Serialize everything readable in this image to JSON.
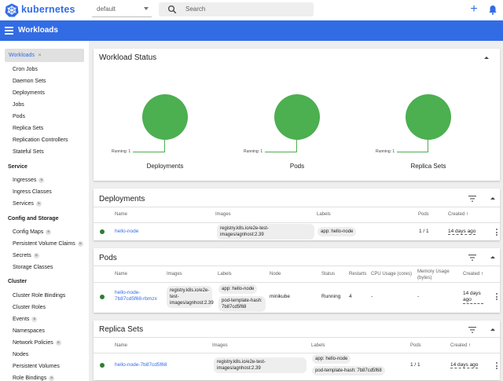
{
  "topbar": {
    "brand": "kubernetes",
    "namespace": "default",
    "search_placeholder": "Search",
    "create_glyph": "+",
    "icons": [
      "kubernetes-logo-icon",
      "chevron-down-icon",
      "search-icon",
      "plus-icon",
      "bell-icon"
    ]
  },
  "header": {
    "title": "Workloads",
    "menu_icon": "menu-icon"
  },
  "colors": {
    "primary": "#326ce5",
    "running": "#4caf50",
    "status_ok": "#2e7d32"
  },
  "sidebar": {
    "workloads": {
      "label": "Workloads",
      "badge": "N"
    },
    "workload_items": [
      "Cron Jobs",
      "Daemon Sets",
      "Deployments",
      "Jobs",
      "Pods",
      "Replica Sets",
      "Replication Controllers",
      "Stateful Sets"
    ],
    "service_heading": "Service",
    "service_items": [
      {
        "label": "Ingresses",
        "badge": "N"
      },
      {
        "label": "Ingress Classes",
        "badge": ""
      },
      {
        "label": "Services",
        "badge": "N"
      }
    ],
    "config_heading": "Config and Storage",
    "config_items": [
      {
        "label": "Config Maps",
        "badge": "N"
      },
      {
        "label": "Persistent Volume Claims",
        "badge": "N"
      },
      {
        "label": "Secrets",
        "badge": "N"
      },
      {
        "label": "Storage Classes",
        "badge": ""
      }
    ],
    "cluster_heading": "Cluster",
    "cluster_items": [
      {
        "label": "Cluster Role Bindings",
        "badge": ""
      },
      {
        "label": "Cluster Roles",
        "badge": ""
      },
      {
        "label": "Events",
        "badge": "N"
      },
      {
        "label": "Namespaces",
        "badge": ""
      },
      {
        "label": "Network Policies",
        "badge": "N"
      },
      {
        "label": "Nodes",
        "badge": ""
      },
      {
        "label": "Persistent Volumes",
        "badge": ""
      },
      {
        "label": "Role Bindings",
        "badge": "N"
      }
    ]
  },
  "workload_status": {
    "title": "Workload Status",
    "charts": [
      {
        "label": "Deployments",
        "running_label": "Running: 1",
        "running": 1
      },
      {
        "label": "Pods",
        "running_label": "Running: 1",
        "running": 1
      },
      {
        "label": "Replica Sets",
        "running_label": "Running: 1",
        "running": 1
      }
    ]
  },
  "deployments": {
    "title": "Deployments",
    "columns": {
      "name": "Name",
      "images": "Images",
      "labels": "Labels",
      "pods": "Pods",
      "created": "Created"
    },
    "rows": [
      {
        "name": "hello-node",
        "image": "registry.k8s.io/e2e-test-images/agnhost:2.39",
        "labels": [
          "app: hello-node"
        ],
        "pods": "1 / 1",
        "created": "14 days ago"
      }
    ]
  },
  "pods": {
    "title": "Pods",
    "columns": {
      "name": "Name",
      "images": "Images",
      "labels": "Labels",
      "node": "Node",
      "status": "Status",
      "restarts": "Restarts",
      "cpu": "CPU Usage (cores)",
      "memory": "Memory Usage (bytes)",
      "created": "Created"
    },
    "rows": [
      {
        "name": "hello-node-7b87cd5f68-rbmzx",
        "image": "registry.k8s.io/e2e-test-images/agnhost:2.39",
        "labels": [
          "app: hello-node",
          "pod-template-hash: 7b87cd5f68"
        ],
        "node": "minikube",
        "status": "Running",
        "restarts": "4",
        "cpu": "-",
        "memory": "-",
        "created": "14 days ago"
      }
    ]
  },
  "replica_sets": {
    "title": "Replica Sets",
    "columns": {
      "name": "Name",
      "images": "Images",
      "labels": "Labels",
      "pods": "Pods",
      "created": "Created"
    },
    "rows": [
      {
        "name": "hello-node-7b87cd5f68",
        "image": "registry.k8s.io/e2e-test-images/agnhost:2.39",
        "labels": [
          "app: hello-node",
          "pod-template-hash: 7b87cd5f68"
        ],
        "pods": "1 / 1",
        "created": "14 days ago"
      }
    ]
  },
  "sort_arrow": "↑"
}
